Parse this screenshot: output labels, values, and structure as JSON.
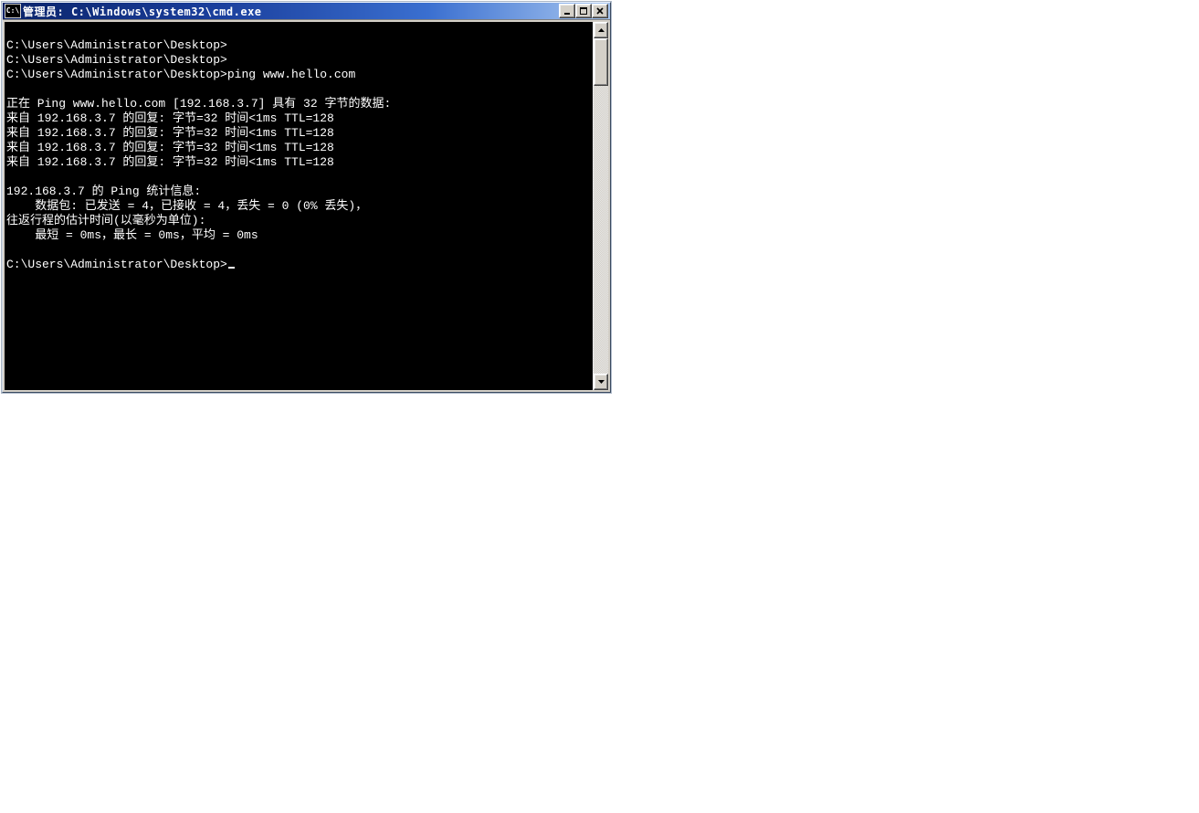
{
  "window": {
    "title_icon_text": "C:\\",
    "title": "管理员: C:\\Windows\\system32\\cmd.exe"
  },
  "console": {
    "lines": [
      "",
      "C:\\Users\\Administrator\\Desktop>",
      "C:\\Users\\Administrator\\Desktop>",
      "C:\\Users\\Administrator\\Desktop>ping www.hello.com",
      "",
      "正在 Ping www.hello.com [192.168.3.7] 具有 32 字节的数据:",
      "来自 192.168.3.7 的回复: 字节=32 时间<1ms TTL=128",
      "来自 192.168.3.7 的回复: 字节=32 时间<1ms TTL=128",
      "来自 192.168.3.7 的回复: 字节=32 时间<1ms TTL=128",
      "来自 192.168.3.7 的回复: 字节=32 时间<1ms TTL=128",
      "",
      "192.168.3.7 的 Ping 统计信息:",
      "    数据包: 已发送 = 4，已接收 = 4，丢失 = 0 (0% 丢失)，",
      "往返行程的估计时间(以毫秒为单位):",
      "    最短 = 0ms，最长 = 0ms，平均 = 0ms",
      "",
      "C:\\Users\\Administrator\\Desktop>"
    ],
    "cursor_after_last": true
  }
}
